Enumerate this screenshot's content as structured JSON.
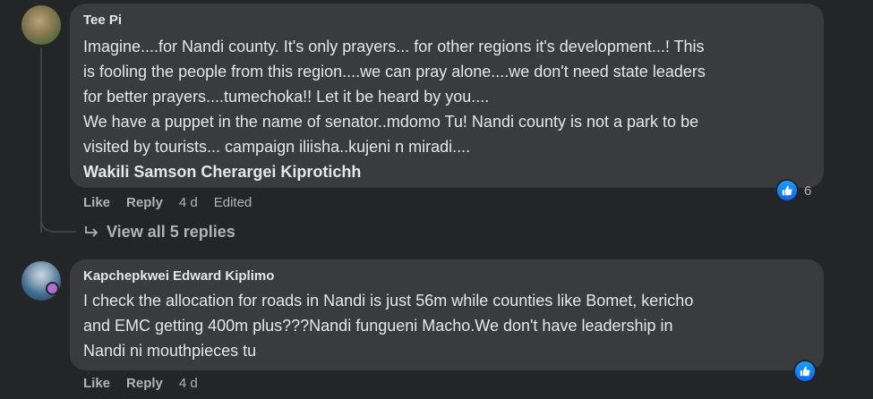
{
  "comments": [
    {
      "author": "Tee Pi",
      "lines": [
        "Imagine....for Nandi county. It's only prayers... for other regions it's development...! This",
        "is fooling the people from this region....we can pray alone....we don't need state leaders",
        "for better prayers....tumechoka!! Let it be heard by you....",
        "We have a puppet in the name of senator..mdomo Tu! Nandi county is not a park to be",
        "visited by tourists... campaign iliisha..kujeni n miradi...."
      ],
      "signature": "Wakili Samson Cherargei Kiprotichh",
      "actions": {
        "like": "Like",
        "reply": "Reply",
        "time": "4 d",
        "edited": "Edited"
      },
      "reaction_count": "6",
      "view_replies": "View all 5 replies"
    },
    {
      "author": "Kapchepkwei Edward Kiplimo",
      "lines": [
        "I check the allocation for roads in Nandi is just 56m while counties like Bomet, kericho",
        "and EMC getting 400m plus???Nandi fungueni Macho.We don't have leadership in",
        "Nandi ni mouthpieces tu"
      ],
      "actions": {
        "like": "Like",
        "reply": "Reply",
        "time": "4 d"
      },
      "reaction_count": ""
    }
  ],
  "icons": {
    "like_reaction": "like-thumb-icon",
    "reply_arrow": "reply-arrow-icon"
  },
  "colors": {
    "background": "#242526",
    "bubble": "#3a3b3c",
    "text": "#e4e6eb",
    "secondary_text": "#b0b3b8",
    "like_blue": "#0866ff"
  }
}
